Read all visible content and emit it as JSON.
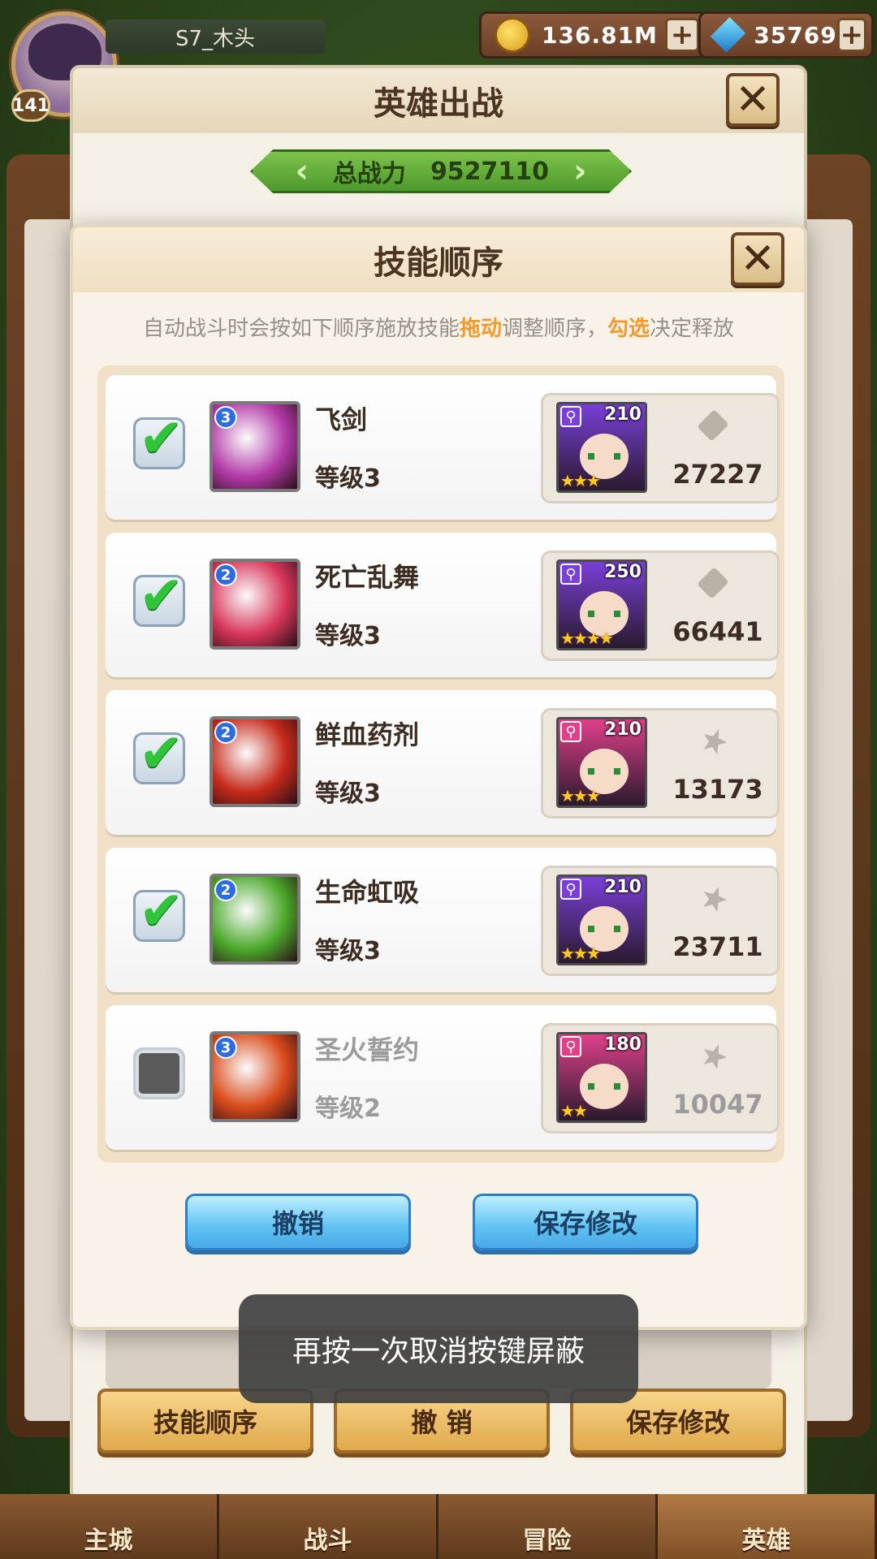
{
  "hud": {
    "player_name": "S7_木头",
    "player_level": "141",
    "gold": "136.81M",
    "gems": "35769"
  },
  "deploy_panel": {
    "title": "英雄出战",
    "power_label": "总战力",
    "power_value": "9527110",
    "buttons": [
      "技能顺序",
      "撤 销",
      "保存修改"
    ]
  },
  "skill_modal": {
    "title": "技能顺序",
    "hint_prefix": "自动战斗时会按如下顺序施放技能",
    "hint_drag": "拖动",
    "hint_mid": "调整顺序，",
    "hint_check": "勾选",
    "hint_suffix": "决定释放",
    "skills": [
      {
        "name": "飞剑",
        "level_text": "等级3",
        "badge": "3",
        "checked": true,
        "hero_level": "210",
        "power": "27227",
        "icon_color": "#b23aa8",
        "hero_class_color": "#7a3fd8",
        "hero_stars": "★★★",
        "weapon": "sword"
      },
      {
        "name": "死亡乱舞",
        "level_text": "等级3",
        "badge": "2",
        "checked": true,
        "hero_level": "250",
        "power": "66441",
        "icon_color": "#d8365a",
        "hero_class_color": "#7a3fd8",
        "hero_stars": "★★★★",
        "weapon": "sword"
      },
      {
        "name": "鲜血药剂",
        "level_text": "等级3",
        "badge": "2",
        "checked": true,
        "hero_level": "210",
        "power": "13173",
        "icon_color": "#c62a1a",
        "hero_class_color": "#e0408a",
        "hero_stars": "★★★",
        "weapon": "star"
      },
      {
        "name": "生命虹吸",
        "level_text": "等级3",
        "badge": "2",
        "checked": true,
        "hero_level": "210",
        "power": "23711",
        "icon_color": "#4aa82a",
        "hero_class_color": "#7a3fd8",
        "hero_stars": "★★★",
        "weapon": "star"
      },
      {
        "name": "圣火誓约",
        "level_text": "等级2",
        "badge": "3",
        "checked": false,
        "hero_level": "180",
        "power": "10047",
        "icon_color": "#d84a1a",
        "hero_class_color": "#e0408a",
        "hero_stars": "★★",
        "weapon": "star"
      }
    ],
    "cancel_label": "撤销",
    "save_label": "保存修改"
  },
  "toast": "再按一次取消按键屏蔽",
  "nav": [
    "主城",
    "战斗",
    "冒险",
    "英雄"
  ]
}
